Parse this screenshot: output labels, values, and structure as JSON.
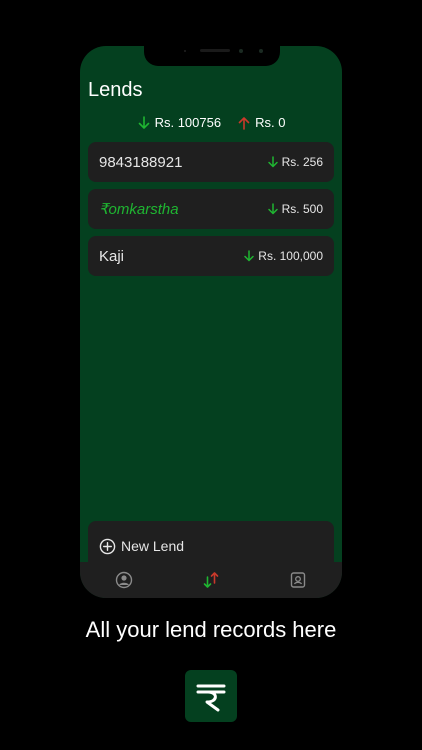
{
  "screen": {
    "title": "Lends",
    "totals": {
      "received": "Rs. 100756",
      "given": "Rs. 0"
    }
  },
  "lends": [
    {
      "name": "9843188921",
      "amount": "Rs. 256"
    },
    {
      "name": "₹omkarstha",
      "amount": "Rs. 500"
    },
    {
      "name": "Kaji",
      "amount": "Rs. 100,000"
    }
  ],
  "actions": {
    "new_lend": "New Lend"
  },
  "tabs": [
    {
      "icon": "user-icon"
    },
    {
      "icon": "lend-arrows-icon"
    },
    {
      "icon": "contacts-icon"
    }
  ],
  "caption": "All your lend records here",
  "colors": {
    "background": "#000000",
    "app_bg": "#04401f",
    "card_bg": "#1f1f1f",
    "down_arrow": "#1fb531",
    "up_arrow": "#c9392b"
  }
}
